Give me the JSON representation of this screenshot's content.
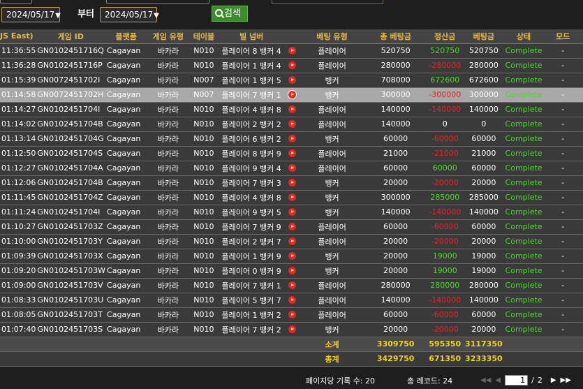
{
  "filters": {
    "start_date": "2024/05/17",
    "end_date": "2024/05/17",
    "from_label": "부터",
    "search_label": "검색"
  },
  "table": {
    "columns": [
      "JS East)",
      "게임 ID",
      "플랫폼",
      "게임 유형",
      "테이블",
      "빌 넘버",
      "베팅 유형",
      "총 베팅금",
      "정산금",
      "베팅금",
      "상태",
      "모드"
    ],
    "rows": [
      {
        "time": "11:36:55",
        "game_id": "GN0102451716Q",
        "platform": "Cagayan",
        "game_type": "바카라",
        "table": "N010",
        "bill": "플레이어 8 뱅커 4",
        "bet_type": "플레이어",
        "total_bet": "520750",
        "settle": "520750",
        "settle_color": "green",
        "bet": "520750",
        "status": "Complete",
        "mode": "-"
      },
      {
        "time": "11:36:28",
        "game_id": "GN0102451716P",
        "platform": "Cagayan",
        "game_type": "바카라",
        "table": "N010",
        "bill": "플레이어 1 뱅커 4",
        "bet_type": "플레이어",
        "total_bet": "280000",
        "settle": "-280000",
        "settle_color": "red",
        "bet": "280000",
        "status": "Complete",
        "mode": "-"
      },
      {
        "time": "01:15:39",
        "game_id": "GN0072451702I",
        "platform": "Cagayan",
        "game_type": "바카라",
        "table": "N007",
        "bill": "플레이어 1 뱅커 5",
        "bet_type": "뱅커",
        "total_bet": "708000",
        "settle": "672600",
        "settle_color": "green",
        "bet": "672600",
        "status": "Complete",
        "mode": "-"
      },
      {
        "time": "01:14:58",
        "game_id": "GN0072451702H",
        "platform": "Cagayan",
        "game_type": "바카라",
        "table": "N007",
        "bill": "플레이어 7 뱅커 1",
        "bet_type": "뱅커",
        "total_bet": "300000",
        "settle": "-300000",
        "settle_color": "red",
        "bet": "300000",
        "status": "Complete",
        "mode": "-"
      },
      {
        "time": "01:14:27",
        "game_id": "GN0102451704I",
        "platform": "Cagayan",
        "game_type": "바카라",
        "table": "N010",
        "bill": "플레이어 4 뱅커 8",
        "bet_type": "플레이어",
        "total_bet": "140000",
        "settle": "-140000",
        "settle_color": "red",
        "bet": "140000",
        "status": "Complete",
        "mode": "-"
      },
      {
        "time": "01:14:02",
        "game_id": "GN0102451704B",
        "platform": "Cagayan",
        "game_type": "바카라",
        "table": "N010",
        "bill": "플레이어 2 뱅커 2",
        "bet_type": "플레이어",
        "total_bet": "140000",
        "settle": "0",
        "settle_color": "white",
        "bet": "0",
        "status": "Complete",
        "mode": "-"
      },
      {
        "time": "01:13:14",
        "game_id": "GN0102451704G",
        "platform": "Cagayan",
        "game_type": "바카라",
        "table": "N010",
        "bill": "플레이어 6 뱅커 2",
        "bet_type": "뱅커",
        "total_bet": "60000",
        "settle": "-60000",
        "settle_color": "red",
        "bet": "60000",
        "status": "Complete",
        "mode": "-"
      },
      {
        "time": "01:12:50",
        "game_id": "GN0102451704S",
        "platform": "Cagayan",
        "game_type": "바카라",
        "table": "N010",
        "bill": "플레이어 8 뱅커 9",
        "bet_type": "플레이어",
        "total_bet": "21000",
        "settle": "-21000",
        "settle_color": "red",
        "bet": "21000",
        "status": "Complete",
        "mode": "-"
      },
      {
        "time": "01:12:27",
        "game_id": "GN0102451704A",
        "platform": "Cagayan",
        "game_type": "바카라",
        "table": "N010",
        "bill": "플레이어 9 뱅커 4",
        "bet_type": "플레이어",
        "total_bet": "60000",
        "settle": "60000",
        "settle_color": "green",
        "bet": "60000",
        "status": "Complete",
        "mode": "-"
      },
      {
        "time": "01:12:06",
        "game_id": "GN0102451704B",
        "platform": "Cagayan",
        "game_type": "바카라",
        "table": "N010",
        "bill": "플레이어 7 뱅커 3",
        "bet_type": "뱅커",
        "total_bet": "20000",
        "settle": "-20000",
        "settle_color": "red",
        "bet": "20000",
        "status": "Complete",
        "mode": "-"
      },
      {
        "time": "01:11:45",
        "game_id": "GN0102451704Z",
        "platform": "Cagayan",
        "game_type": "바카라",
        "table": "N010",
        "bill": "플레이어 4 뱅커 8",
        "bet_type": "뱅커",
        "total_bet": "300000",
        "settle": "285000",
        "settle_color": "green",
        "bet": "285000",
        "status": "Complete",
        "mode": "-"
      },
      {
        "time": "01:11:24",
        "game_id": "GN0102451704I",
        "platform": "Cagayan",
        "game_type": "바카라",
        "table": "N010",
        "bill": "플레이어 9 뱅커 5",
        "bet_type": "뱅커",
        "total_bet": "140000",
        "settle": "-140000",
        "settle_color": "red",
        "bet": "140000",
        "status": "Complete",
        "mode": "-"
      },
      {
        "time": "01:10:27",
        "game_id": "GN0102451703Z",
        "platform": "Cagayan",
        "game_type": "바카라",
        "table": "N010",
        "bill": "플레이어 7 뱅커 9",
        "bet_type": "플레이어",
        "total_bet": "60000",
        "settle": "-60000",
        "settle_color": "red",
        "bet": "60000",
        "status": "Complete",
        "mode": "-"
      },
      {
        "time": "01:10:00",
        "game_id": "GN0102451703Y",
        "platform": "Cagayan",
        "game_type": "바카라",
        "table": "N010",
        "bill": "플레이어 2 뱅커 7",
        "bet_type": "플레이어",
        "total_bet": "20000",
        "settle": "-20000",
        "settle_color": "red",
        "bet": "20000",
        "status": "Complete",
        "mode": "-"
      },
      {
        "time": "01:09:39",
        "game_id": "GN0102451703X",
        "platform": "Cagayan",
        "game_type": "바카라",
        "table": "N010",
        "bill": "플레이어 1 뱅커 9",
        "bet_type": "뱅커",
        "total_bet": "20000",
        "settle": "19000",
        "settle_color": "green",
        "bet": "19000",
        "status": "Complete",
        "mode": "-"
      },
      {
        "time": "01:09:20",
        "game_id": "GN0102451703W",
        "platform": "Cagayan",
        "game_type": "바카라",
        "table": "N010",
        "bill": "플레이어 0 뱅커 9",
        "bet_type": "뱅커",
        "total_bet": "20000",
        "settle": "19000",
        "settle_color": "green",
        "bet": "19000",
        "status": "Complete",
        "mode": "-"
      },
      {
        "time": "01:09:00",
        "game_id": "GN0102451703V",
        "platform": "Cagayan",
        "game_type": "바카라",
        "table": "N010",
        "bill": "플레이어 7 뱅커 1",
        "bet_type": "플레이어",
        "total_bet": "280000",
        "settle": "280000",
        "settle_color": "green",
        "bet": "280000",
        "status": "Complete",
        "mode": "-"
      },
      {
        "time": "01:08:33",
        "game_id": "GN0102451703U",
        "platform": "Cagayan",
        "game_type": "바카라",
        "table": "N010",
        "bill": "플레이어 5 뱅커 7",
        "bet_type": "플레이어",
        "total_bet": "140000",
        "settle": "-140000",
        "settle_color": "red",
        "bet": "140000",
        "status": "Complete",
        "mode": "-"
      },
      {
        "time": "01:08:05",
        "game_id": "GN0102451703T",
        "platform": "Cagayan",
        "game_type": "바카라",
        "table": "N010",
        "bill": "플레이어 1 뱅커 2",
        "bet_type": "플레이어",
        "total_bet": "60000",
        "settle": "-60000",
        "settle_color": "red",
        "bet": "60000",
        "status": "Complete",
        "mode": "-"
      },
      {
        "time": "01:07:40",
        "game_id": "GN0102451703S",
        "platform": "Cagayan",
        "game_type": "바카라",
        "table": "N010",
        "bill": "플레이어 7 뱅커 2",
        "bet_type": "뱅커",
        "total_bet": "20000",
        "settle": "-20000",
        "settle_color": "red",
        "bet": "20000",
        "status": "Complete",
        "mode": "-"
      }
    ],
    "selected_row": 3,
    "subtotal": {
      "label": "소계",
      "total_bet": "3309750",
      "settle": "595350",
      "bet": "3117350"
    },
    "total": {
      "label": "총계",
      "total_bet": "3429750",
      "settle": "671350",
      "bet": "3233350"
    }
  },
  "footer": {
    "per_page": "페이지당 기록 수: 20",
    "total_records": "총 레코드: 24",
    "current_page": "1",
    "separator": "/",
    "max_page": "2"
  },
  "colors": {
    "header_text": "#e8b84a",
    "positive": "#44dd22",
    "negative": "#ee2222",
    "summary": "#f0d020",
    "accent_border": "#c8a050"
  },
  "icons": {
    "play": "play-circle-icon",
    "search": "search-icon",
    "dropdown": "triangle-down-icon",
    "first": "double-chevron-left-icon",
    "prev": "chevron-left-icon",
    "next": "chevron-right-icon",
    "last": "double-chevron-right-icon"
  }
}
